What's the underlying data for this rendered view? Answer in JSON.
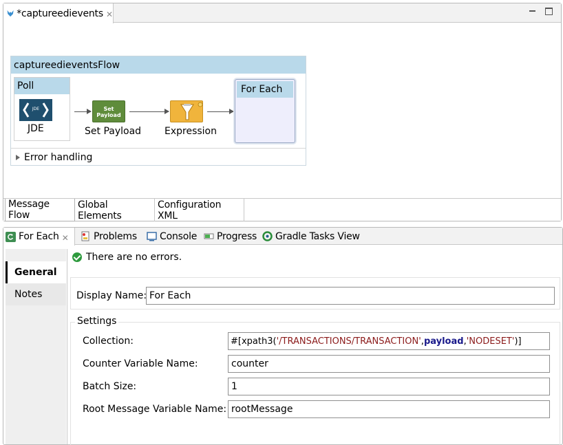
{
  "editor": {
    "tab_label": "*captureedievents",
    "flow": {
      "title": "captureedieventsFlow",
      "poll_label": "Poll",
      "jde_icon_text": "JDE",
      "source_label": "JDE",
      "set_payload_icon_text_1": "Set",
      "set_payload_icon_text_2": "Payload",
      "set_payload_label": "Set Payload",
      "expression_label": "Expression",
      "for_each_label": "For Each",
      "error_handling_label": "Error handling"
    },
    "bottom_tabs": [
      "Message Flow",
      "Global Elements",
      "Configuration XML"
    ]
  },
  "props": {
    "tabs": {
      "for_each": "For Each",
      "problems": "Problems",
      "console": "Console",
      "progress": "Progress",
      "gradle": "Gradle Tasks View"
    },
    "nav": {
      "general": "General",
      "notes": "Notes"
    },
    "status": "There are no errors.",
    "display_name_label": "Display Name:",
    "display_name_value": "For Each",
    "settings_legend": "Settings",
    "collection_label": "Collection:",
    "collection_value": {
      "p1": "#[xpath3(",
      "p2": "'/TRANSACTIONS/TRANSACTION'",
      "p3": ",",
      "p4": "payload",
      "p5": ",",
      "p6": "'NODESET'",
      "p7": ")]"
    },
    "counter_label": "Counter Variable Name:",
    "counter_value": "counter",
    "batch_label": "Batch Size:",
    "batch_value": "1",
    "root_label": "Root Message Variable Name:",
    "root_value": "rootMessage"
  }
}
